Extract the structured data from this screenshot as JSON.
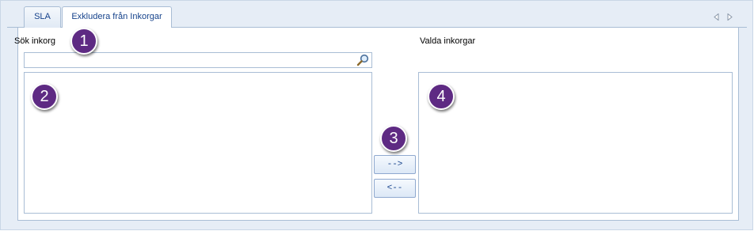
{
  "tabs": [
    {
      "label": "SLA",
      "active": false
    },
    {
      "label": "Exkludera från Inkorgar",
      "active": true
    }
  ],
  "search": {
    "label": "Sök inkorg",
    "value": "",
    "icon": "search-icon"
  },
  "available_list": {
    "items": []
  },
  "selected": {
    "label": "Valda inkorgar",
    "items": []
  },
  "buttons": {
    "add_label": "-->",
    "remove_label": "<--"
  },
  "annotations": [
    "1",
    "2",
    "3",
    "4"
  ],
  "colors": {
    "badge": "#5e2a83",
    "tab_text": "#15428b",
    "border": "#a9bdd5",
    "background": "#e6edf6"
  }
}
